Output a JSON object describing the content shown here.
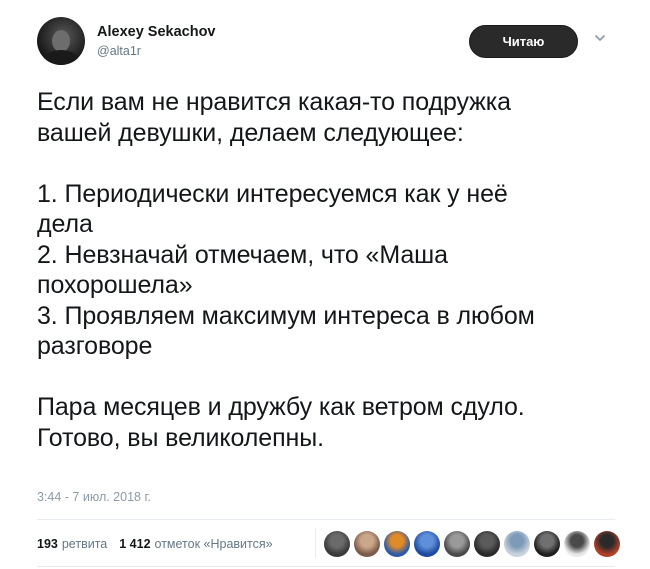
{
  "author": {
    "name": "Alexey Sekachov",
    "handle": "@alta1r"
  },
  "follow_button": {
    "label": "Читаю"
  },
  "tweet": {
    "text": "Если вам не нравится какая-то подружка\nвашей девушки, делаем следующее:\n\n1. Периодически интересуемся как у неё\nдела\n2. Невзначай отмечаем, что «Маша\nпохорошела»\n3. Проявляем максимум интереса в любом\nразговоре\n\nПара месяцев и дружбу как ветром сдуло.\nГотово, вы великолепны.",
    "timestamp": "3:44 - 7 июл. 2018 г."
  },
  "stats": {
    "retweets_count": "193",
    "retweets_label": "ретвита",
    "likes_count": "1 412",
    "likes_label": "отметок «Нравится»"
  },
  "icons": {
    "caret": "chevron-down-icon"
  },
  "colors": {
    "text": "#14171a",
    "muted": "#657786",
    "divider": "#e6ecf0",
    "button_bg": "#2a2a2a"
  },
  "liker_avatars": [
    {
      "name": "liker-avatar-1",
      "color": "#3a3a3a",
      "accent": "#6a6a6a"
    },
    {
      "name": "liker-avatar-2",
      "color": "#7a5a48",
      "accent": "#caa68a"
    },
    {
      "name": "liker-avatar-3",
      "color": "#2d5aa8",
      "accent": "#e08a2a"
    },
    {
      "name": "liker-avatar-4",
      "color": "#1f4aa0",
      "accent": "#5f8fd8"
    },
    {
      "name": "liker-avatar-5",
      "color": "#4a4a4a",
      "accent": "#9a9a9a"
    },
    {
      "name": "liker-avatar-6",
      "color": "#2a2a2a",
      "accent": "#5a5a5a"
    },
    {
      "name": "liker-avatar-7",
      "color": "#c8d2dc",
      "accent": "#7d9ab8"
    },
    {
      "name": "liker-avatar-8",
      "color": "#1e1e1e",
      "accent": "#707070"
    },
    {
      "name": "liker-avatar-9",
      "color": "#e8e8e8",
      "accent": "#4a4a4a"
    },
    {
      "name": "liker-avatar-10",
      "color": "#b0402a",
      "accent": "#2a2a2a"
    }
  ]
}
